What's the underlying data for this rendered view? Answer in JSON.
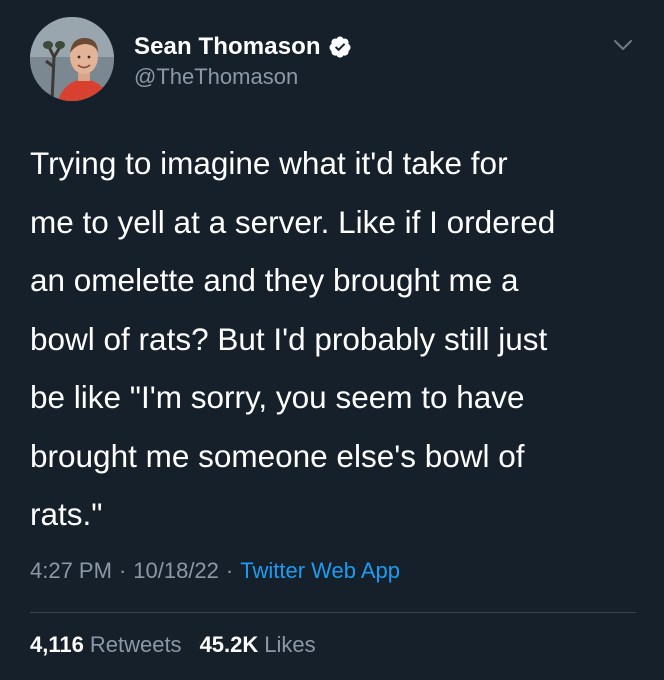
{
  "author": {
    "display_name": "Sean Thomason",
    "handle": "@TheThomason",
    "verified": true,
    "verified_color": "#ffffff",
    "avatar_icon": "profile-photo"
  },
  "tweet": {
    "text_lines": [
      "Trying to imagine what it'd take for",
      "me to yell at a server. Like if I ordered",
      "an omelette and they brought me a",
      "bowl of rats? But I'd probably still just",
      "be like \"I'm sorry, you seem to have",
      "brought me someone else's bowl of",
      "rats.\""
    ],
    "time": "4:27 PM",
    "separator": "·",
    "date": "10/18/22",
    "source": "Twitter Web App"
  },
  "stats": {
    "retweets_count": "4,116",
    "retweets_label": "Retweets",
    "likes_count": "45.2K",
    "likes_label": "Likes"
  },
  "colors": {
    "background": "#15202b",
    "text_primary": "#ffffff",
    "text_secondary": "#8b98a5",
    "link": "#1d9bf0",
    "divider": "#38444d"
  },
  "icons": {
    "menu": "chevron-down-icon",
    "verified": "verified-badge-icon"
  }
}
